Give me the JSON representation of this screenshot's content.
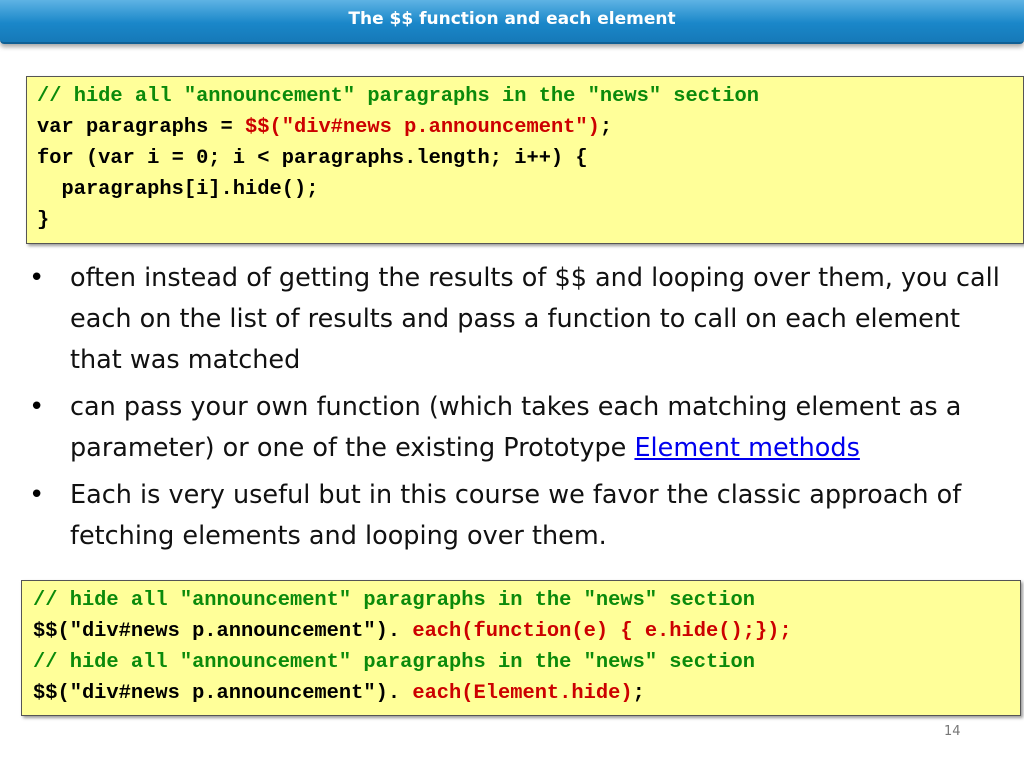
{
  "title": "The $$ function and each element",
  "code_block_1": {
    "line1": "// hide all \"announcement\" paragraphs in the \"news\" section",
    "line2_a": "var paragraphs = ",
    "line2_b": "$$(\"div#news p.announcement\")",
    "line2_c": ";",
    "line3": "for (var i = 0; i < paragraphs.length; i++) {",
    "line4": "  paragraphs[i].hide();",
    "line5": "}"
  },
  "bullets": {
    "b1": "often instead of getting the results of $$ and looping over them, you call each on the list of results and pass a function to call on each element that was matched",
    "b2_text": "can pass your own function (which takes each matching element as a parameter) or one of the existing Prototype ",
    "b2_link": "Element methods",
    "b3": "Each is very useful but in this course we favor the classic approach of fetching elements and looping over them.",
    "marker": "•"
  },
  "code_block_2": {
    "line1": "// hide all \"announcement\" paragraphs in the \"news\" section",
    "line2_a": "$$(\"div#news p.announcement\"). ",
    "line2_b": "each(function(e) { e.hide();});",
    "line3": "// hide all \"announcement\" paragraphs in the \"news\" section",
    "line4_a": "$$(\"div#news p.announcement\"). ",
    "line4_b": "each(Element.hide)",
    "line4_c": ";"
  },
  "page_number": "14"
}
